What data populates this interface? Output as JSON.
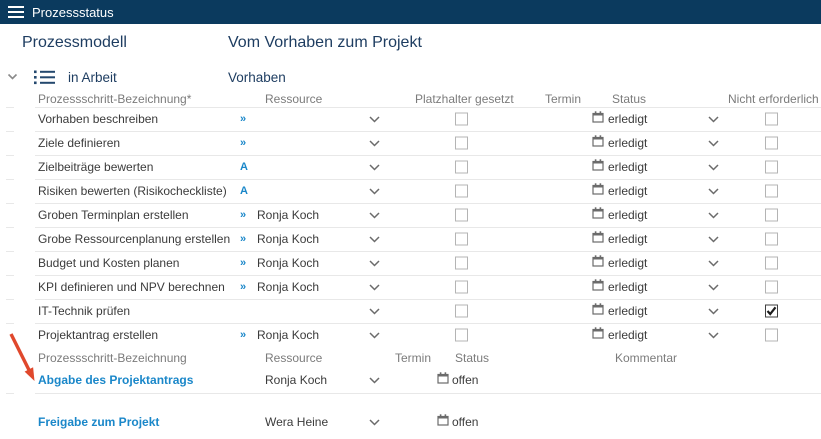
{
  "topbar": {
    "title": "Prozessstatus"
  },
  "headings": {
    "model": "Prozessmodell",
    "process": "Vom Vorhaben zum Projekt"
  },
  "section": {
    "state": "in Arbeit",
    "phase": "Vorhaben"
  },
  "table1": {
    "headers": {
      "name": "Prozessschritt-Bezeichnung*",
      "resource": "Ressource",
      "placeholder": "Platzhalter gesetzt",
      "due": "Termin",
      "status": "Status",
      "not_required": "Nicht erforderlich"
    },
    "rows": [
      {
        "name": "Vorhaben beschreiben",
        "res_icon": "»",
        "resource": "",
        "status": "erledigt",
        "placeholder_checked": false,
        "not_required_checked": false
      },
      {
        "name": "Ziele definieren",
        "res_icon": "»",
        "resource": "",
        "status": "erledigt",
        "placeholder_checked": false,
        "not_required_checked": false
      },
      {
        "name": "Zielbeiträge bewerten",
        "res_icon": "A",
        "resource": "",
        "status": "erledigt",
        "placeholder_checked": false,
        "not_required_checked": false
      },
      {
        "name": "Risiken bewerten (Risikocheckliste)",
        "res_icon": "A",
        "resource": "",
        "status": "erledigt",
        "placeholder_checked": false,
        "not_required_checked": false
      },
      {
        "name": "Groben Terminplan erstellen",
        "res_icon": "»",
        "resource": "Ronja Koch",
        "status": "erledigt",
        "placeholder_checked": false,
        "not_required_checked": false
      },
      {
        "name": "Grobe Ressourcenplanung erstellen",
        "res_icon": "»",
        "resource": "Ronja Koch",
        "status": "erledigt",
        "placeholder_checked": false,
        "not_required_checked": false
      },
      {
        "name": "Budget und Kosten planen",
        "res_icon": "»",
        "resource": "Ronja Koch",
        "status": "erledigt",
        "placeholder_checked": false,
        "not_required_checked": false
      },
      {
        "name": "KPI definieren und NPV berechnen",
        "res_icon": "»",
        "resource": "Ronja Koch",
        "status": "erledigt",
        "placeholder_checked": false,
        "not_required_checked": false
      },
      {
        "name": "IT-Technik prüfen",
        "res_icon": "",
        "resource": "",
        "status": "erledigt",
        "placeholder_checked": false,
        "not_required_checked": true
      },
      {
        "name": "Projektantrag erstellen",
        "res_icon": "»",
        "resource": "Ronja Koch",
        "status": "erledigt",
        "placeholder_checked": false,
        "not_required_checked": false
      }
    ]
  },
  "table2": {
    "headers": {
      "name": "Prozessschritt-Bezeichnung",
      "resource": "Ressource",
      "due": "Termin",
      "status": "Status",
      "comment": "Kommentar"
    },
    "rows": [
      {
        "name": "Abgabe des Projektantrags",
        "resource": "Ronja Koch",
        "status": "offen",
        "comment": ""
      },
      {
        "name": "Freigabe zum Projekt",
        "resource": "Wera Heine",
        "status": "offen",
        "comment": ""
      }
    ]
  },
  "icons": {
    "menu": "hamburger-icon",
    "section_collapse": "chevron-down-icon",
    "section_type": "list-icon",
    "dropdown": "chevron-down-icon",
    "date": "calendar-icon",
    "resource_delegate_glyph": "»",
    "resource_auto_glyph": "A"
  },
  "colors": {
    "topbar_bg": "#0b3a5e",
    "navy_text": "#1e3d61",
    "accent_blue": "#1a87c9",
    "row_text": "#3b3b3b",
    "header_text": "#7b7b7b",
    "separator": "#e8e8e8",
    "arrow_red": "#e0482c"
  }
}
